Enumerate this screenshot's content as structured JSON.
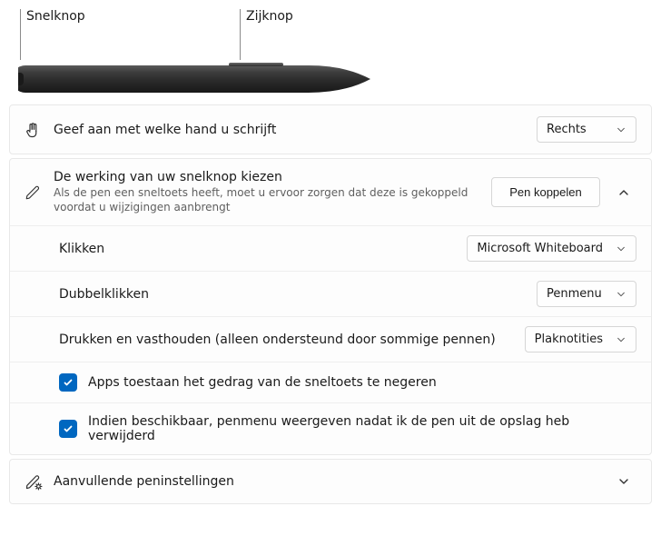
{
  "diagram": {
    "quick_button_label": "Snelknop",
    "side_button_label": "Zijknop"
  },
  "hand": {
    "title": "Geef aan met welke hand u schrijft",
    "value": "Rechts"
  },
  "shortcut": {
    "title": "De werking van uw snelknop kiezen",
    "desc": "Als de pen een sneltoets heeft, moet u ervoor zorgen dat deze is gekoppeld voordat u wijzigingen aanbrengt",
    "pair_button": "Pen koppelen",
    "click_label": "Klikken",
    "click_value": "Microsoft Whiteboard",
    "dblclick_label": "Dubbelklikken",
    "dblclick_value": "Penmenu",
    "hold_label": "Drukken en vasthouden (alleen ondersteund door sommige pennen)",
    "hold_value": "Plaknotities",
    "checkbox_override": "Apps toestaan het gedrag van de sneltoets te negeren",
    "checkbox_penmenu": "Indien beschikbaar, penmenu weergeven nadat ik de pen uit de opslag heb verwijderd"
  },
  "additional": {
    "title": "Aanvullende peninstellingen"
  }
}
